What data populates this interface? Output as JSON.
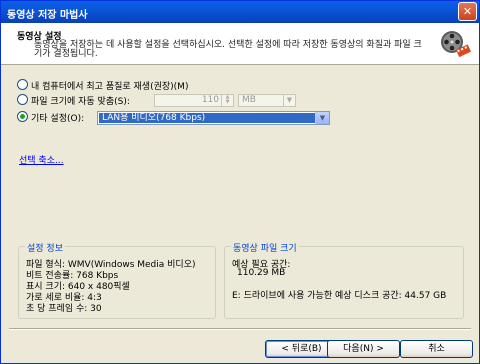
{
  "window": {
    "title": "동영상 저장 마법사",
    "close_glyph": "✕"
  },
  "header": {
    "title": "동영상 설정",
    "description": "동영상을 저장하는 데 사용할 설정을 선택하십시오. 선택한 설정에 따라 저장한 동영상의 화질과 파일 크기가 결정됩니다.",
    "icon": "film-reel-icon"
  },
  "options": {
    "best_quality_label": "내 컴퓨터에서 최고 품질로 재생(권장)(M)",
    "fit_size_label": "파일 크기에 자동 맞춤(S):",
    "fit_size_value": "110",
    "fit_size_unit": "MB",
    "other_label": "기타 설정(O):",
    "other_value": "LAN용 비디오(768 Kbps)",
    "selected": "other"
  },
  "less_choices_link": "선택 축소...",
  "settings_info": {
    "title": "설정 정보",
    "lines": [
      "파일 형식: WMV(Windows Media 비디오)",
      "비트 전송률: 768 Kbps",
      "표시 크기: 640 x 480픽셀",
      "가로 세로 비율: 4:3",
      "초 당 프레임 수: 30"
    ]
  },
  "file_size": {
    "title": "동영상 파일 크기",
    "needed_label": "예상 필요 공간:",
    "needed_value": "110.29 MB",
    "available": "E: 드라이브에 사용 가능한 예상 디스크 공간: 44.57 GB"
  },
  "buttons": {
    "back": "< 뒤로(B)",
    "next": "다음(N) >",
    "cancel": "취소"
  },
  "colors": {
    "titlebar": "#0a5fe8",
    "link": "#0000ff",
    "group_title": "#0046d5",
    "selection": "#316ac5"
  }
}
